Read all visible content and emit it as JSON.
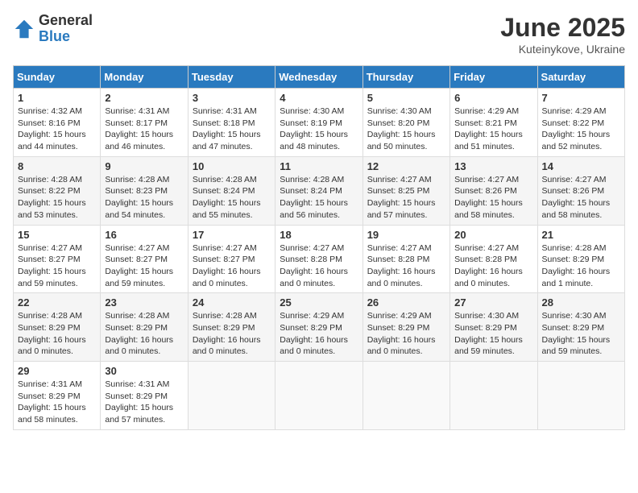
{
  "logo": {
    "general": "General",
    "blue": "Blue"
  },
  "title": "June 2025",
  "subtitle": "Kuteinykove, Ukraine",
  "weekdays": [
    "Sunday",
    "Monday",
    "Tuesday",
    "Wednesday",
    "Thursday",
    "Friday",
    "Saturday"
  ],
  "weeks": [
    [
      {
        "day": "1",
        "info": "Sunrise: 4:32 AM\nSunset: 8:16 PM\nDaylight: 15 hours\nand 44 minutes."
      },
      {
        "day": "2",
        "info": "Sunrise: 4:31 AM\nSunset: 8:17 PM\nDaylight: 15 hours\nand 46 minutes."
      },
      {
        "day": "3",
        "info": "Sunrise: 4:31 AM\nSunset: 8:18 PM\nDaylight: 15 hours\nand 47 minutes."
      },
      {
        "day": "4",
        "info": "Sunrise: 4:30 AM\nSunset: 8:19 PM\nDaylight: 15 hours\nand 48 minutes."
      },
      {
        "day": "5",
        "info": "Sunrise: 4:30 AM\nSunset: 8:20 PM\nDaylight: 15 hours\nand 50 minutes."
      },
      {
        "day": "6",
        "info": "Sunrise: 4:29 AM\nSunset: 8:21 PM\nDaylight: 15 hours\nand 51 minutes."
      },
      {
        "day": "7",
        "info": "Sunrise: 4:29 AM\nSunset: 8:22 PM\nDaylight: 15 hours\nand 52 minutes."
      }
    ],
    [
      {
        "day": "8",
        "info": "Sunrise: 4:28 AM\nSunset: 8:22 PM\nDaylight: 15 hours\nand 53 minutes."
      },
      {
        "day": "9",
        "info": "Sunrise: 4:28 AM\nSunset: 8:23 PM\nDaylight: 15 hours\nand 54 minutes."
      },
      {
        "day": "10",
        "info": "Sunrise: 4:28 AM\nSunset: 8:24 PM\nDaylight: 15 hours\nand 55 minutes."
      },
      {
        "day": "11",
        "info": "Sunrise: 4:28 AM\nSunset: 8:24 PM\nDaylight: 15 hours\nand 56 minutes."
      },
      {
        "day": "12",
        "info": "Sunrise: 4:27 AM\nSunset: 8:25 PM\nDaylight: 15 hours\nand 57 minutes."
      },
      {
        "day": "13",
        "info": "Sunrise: 4:27 AM\nSunset: 8:26 PM\nDaylight: 15 hours\nand 58 minutes."
      },
      {
        "day": "14",
        "info": "Sunrise: 4:27 AM\nSunset: 8:26 PM\nDaylight: 15 hours\nand 58 minutes."
      }
    ],
    [
      {
        "day": "15",
        "info": "Sunrise: 4:27 AM\nSunset: 8:27 PM\nDaylight: 15 hours\nand 59 minutes."
      },
      {
        "day": "16",
        "info": "Sunrise: 4:27 AM\nSunset: 8:27 PM\nDaylight: 15 hours\nand 59 minutes."
      },
      {
        "day": "17",
        "info": "Sunrise: 4:27 AM\nSunset: 8:27 PM\nDaylight: 16 hours\nand 0 minutes."
      },
      {
        "day": "18",
        "info": "Sunrise: 4:27 AM\nSunset: 8:28 PM\nDaylight: 16 hours\nand 0 minutes."
      },
      {
        "day": "19",
        "info": "Sunrise: 4:27 AM\nSunset: 8:28 PM\nDaylight: 16 hours\nand 0 minutes."
      },
      {
        "day": "20",
        "info": "Sunrise: 4:27 AM\nSunset: 8:28 PM\nDaylight: 16 hours\nand 0 minutes."
      },
      {
        "day": "21",
        "info": "Sunrise: 4:28 AM\nSunset: 8:29 PM\nDaylight: 16 hours\nand 1 minute."
      }
    ],
    [
      {
        "day": "22",
        "info": "Sunrise: 4:28 AM\nSunset: 8:29 PM\nDaylight: 16 hours\nand 0 minutes."
      },
      {
        "day": "23",
        "info": "Sunrise: 4:28 AM\nSunset: 8:29 PM\nDaylight: 16 hours\nand 0 minutes."
      },
      {
        "day": "24",
        "info": "Sunrise: 4:28 AM\nSunset: 8:29 PM\nDaylight: 16 hours\nand 0 minutes."
      },
      {
        "day": "25",
        "info": "Sunrise: 4:29 AM\nSunset: 8:29 PM\nDaylight: 16 hours\nand 0 minutes."
      },
      {
        "day": "26",
        "info": "Sunrise: 4:29 AM\nSunset: 8:29 PM\nDaylight: 16 hours\nand 0 minutes."
      },
      {
        "day": "27",
        "info": "Sunrise: 4:30 AM\nSunset: 8:29 PM\nDaylight: 15 hours\nand 59 minutes."
      },
      {
        "day": "28",
        "info": "Sunrise: 4:30 AM\nSunset: 8:29 PM\nDaylight: 15 hours\nand 59 minutes."
      }
    ],
    [
      {
        "day": "29",
        "info": "Sunrise: 4:31 AM\nSunset: 8:29 PM\nDaylight: 15 hours\nand 58 minutes."
      },
      {
        "day": "30",
        "info": "Sunrise: 4:31 AM\nSunset: 8:29 PM\nDaylight: 15 hours\nand 57 minutes."
      },
      null,
      null,
      null,
      null,
      null
    ]
  ]
}
